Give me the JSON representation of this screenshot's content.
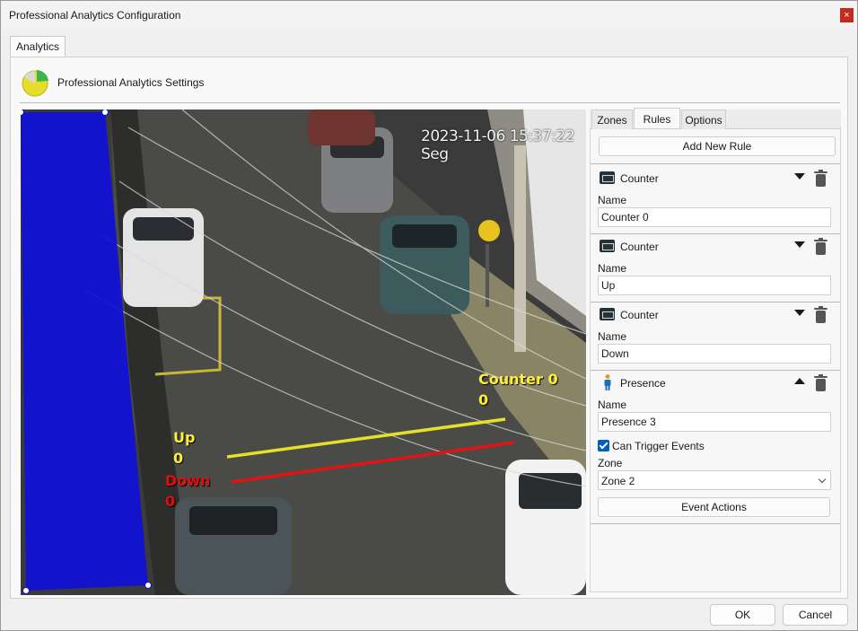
{
  "window": {
    "title": "Professional Analytics Configuration",
    "close_label": "×"
  },
  "tabs": {
    "main": "Analytics"
  },
  "header": {
    "title": "Professional Analytics Settings"
  },
  "video": {
    "timestamp": "2023-11-06 15:37:22 Seg",
    "overlays": {
      "counter0_name": "Counter 0",
      "counter0_value": "0",
      "up_name": "Up",
      "up_value": "0",
      "down_name": "Down",
      "down_value": "0"
    },
    "colors": {
      "zone": "#1010d8",
      "up_line": "#e8e028",
      "down_line": "#e01414"
    }
  },
  "right_tabs": {
    "zones": "Zones",
    "rules": "Rules",
    "options": "Options",
    "active": "Rules"
  },
  "rules_panel": {
    "add_button": "Add New Rule",
    "name_label": "Name",
    "rules": [
      {
        "type": "Counter",
        "name": "Counter 0",
        "icon": "counter-icon",
        "expanded": false
      },
      {
        "type": "Counter",
        "name": "Up",
        "icon": "counter-icon",
        "expanded": false
      },
      {
        "type": "Counter",
        "name": "Down",
        "icon": "counter-icon",
        "expanded": false
      },
      {
        "type": "Presence",
        "name": "Presence 3",
        "icon": "person-icon",
        "expanded": true
      }
    ],
    "presence_details": {
      "trigger_label": "Can Trigger Events",
      "trigger_checked": true,
      "zone_label": "Zone",
      "zone_value": "Zone 2",
      "event_actions_button": "Event Actions"
    }
  },
  "footer": {
    "ok": "OK",
    "cancel": "Cancel"
  }
}
